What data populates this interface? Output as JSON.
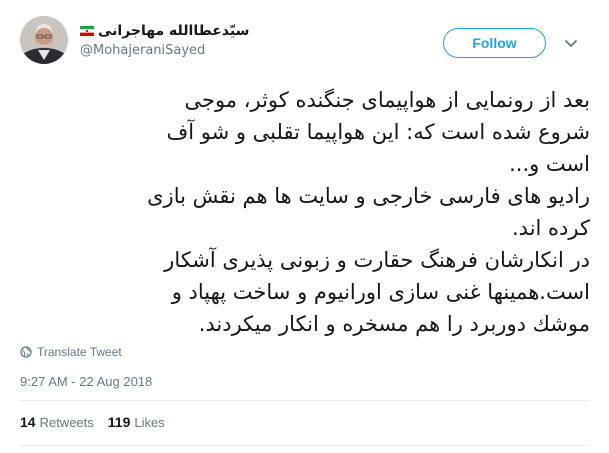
{
  "author": {
    "display_name": "سیّدعطاالله مهاجرانی",
    "handle": "@MohajeraniSayed",
    "flag_icon": "iran-flag-icon"
  },
  "follow_label": "Follow",
  "tweet": {
    "lines": [
      "بعد از رونمایی از هواپیمای جنگنده کوثر، موجی",
      "شروع شده است که: این هواپیما تقلبی و شو آف",
      "است و...",
      "رادیو های فارسی خارجی و سایت ها هم نقش بازی",
      "کرده اند.",
      "در انکارشان فرهنگ حقارت و زبونی پذیری آشکار",
      "است.همینها غنی سازی اورانیوم و ساخت پهپاد و",
      "موشك دوربرد را هم مسخره و انكار میکردند."
    ]
  },
  "translate_label": "Translate Tweet",
  "timestamp": "9:27 AM - 22 Aug 2018",
  "stats": {
    "retweets_count": "14",
    "retweets_label": "Retweets",
    "likes_count": "119",
    "likes_label": "Likes"
  },
  "colors": {
    "accent": "#1da1f2",
    "secondary_text": "#657786",
    "divider": "#e6ecf0"
  }
}
